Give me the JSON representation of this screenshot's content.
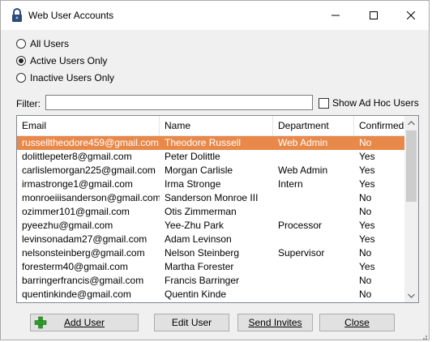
{
  "window": {
    "title": "Web User Accounts",
    "controls": {
      "minimize": "—",
      "maximize": "☐",
      "close": "✕"
    }
  },
  "filters": {
    "radios": [
      {
        "label": "All Users",
        "checked": false
      },
      {
        "label": "Active Users Only",
        "checked": true
      },
      {
        "label": "Inactive Users Only",
        "checked": false
      }
    ],
    "filter_label": "Filter:",
    "filter_value": "",
    "adhoc_label": "Show Ad Hoc Users",
    "adhoc_checked": false
  },
  "table": {
    "columns": [
      "Email",
      "Name",
      "Department",
      "Confirmed"
    ],
    "rows": [
      {
        "email": "russelltheodore459@gmail.com",
        "name": "Theodore Russell",
        "dept": "Web Admin",
        "confirmed": "No",
        "selected": true
      },
      {
        "email": "dolittlepeter8@gmail.com",
        "name": "Peter Dolittle",
        "dept": "",
        "confirmed": "Yes"
      },
      {
        "email": "carlislemorgan225@gmail.com",
        "name": "Morgan Carlisle",
        "dept": "Web Admin",
        "confirmed": "Yes"
      },
      {
        "email": "irmastronge1@gmail.com",
        "name": "Irma Stronge",
        "dept": "Intern",
        "confirmed": "Yes"
      },
      {
        "email": "monroeiiisanderson@gmail.com",
        "name": "Sanderson Monroe III",
        "dept": "",
        "confirmed": "No"
      },
      {
        "email": "ozimmer101@gmail.com",
        "name": "Otis Zimmerman",
        "dept": "",
        "confirmed": "No"
      },
      {
        "email": "pyeezhu@gmail.com",
        "name": "Yee-Zhu Park",
        "dept": "Processor",
        "confirmed": "Yes"
      },
      {
        "email": "levinsonadam27@gmail.com",
        "name": "Adam Levinson",
        "dept": "",
        "confirmed": "Yes"
      },
      {
        "email": "nelsonsteinberg@gmail.com",
        "name": "Nelson Steinberg",
        "dept": "Supervisor",
        "confirmed": "No"
      },
      {
        "email": "foresterm40@gmail.com",
        "name": "Martha Forester",
        "dept": "",
        "confirmed": "Yes"
      },
      {
        "email": "barringerfrancis@gmail.com",
        "name": "Francis Barringer",
        "dept": "",
        "confirmed": "No"
      },
      {
        "email": "quentinkinde@gmail.com",
        "name": "Quentin Kinde",
        "dept": "",
        "confirmed": "No"
      }
    ]
  },
  "buttons": {
    "add_user": "Add User",
    "edit_user": "Edit User",
    "send_invites": "Send Invites",
    "close": "Close"
  },
  "colors": {
    "selection": "#e8894a",
    "window_bg": "#f0f0f0",
    "add_icon": "#2e9b2e"
  },
  "icons": {
    "app": "lock-icon",
    "add": "plus-icon"
  }
}
